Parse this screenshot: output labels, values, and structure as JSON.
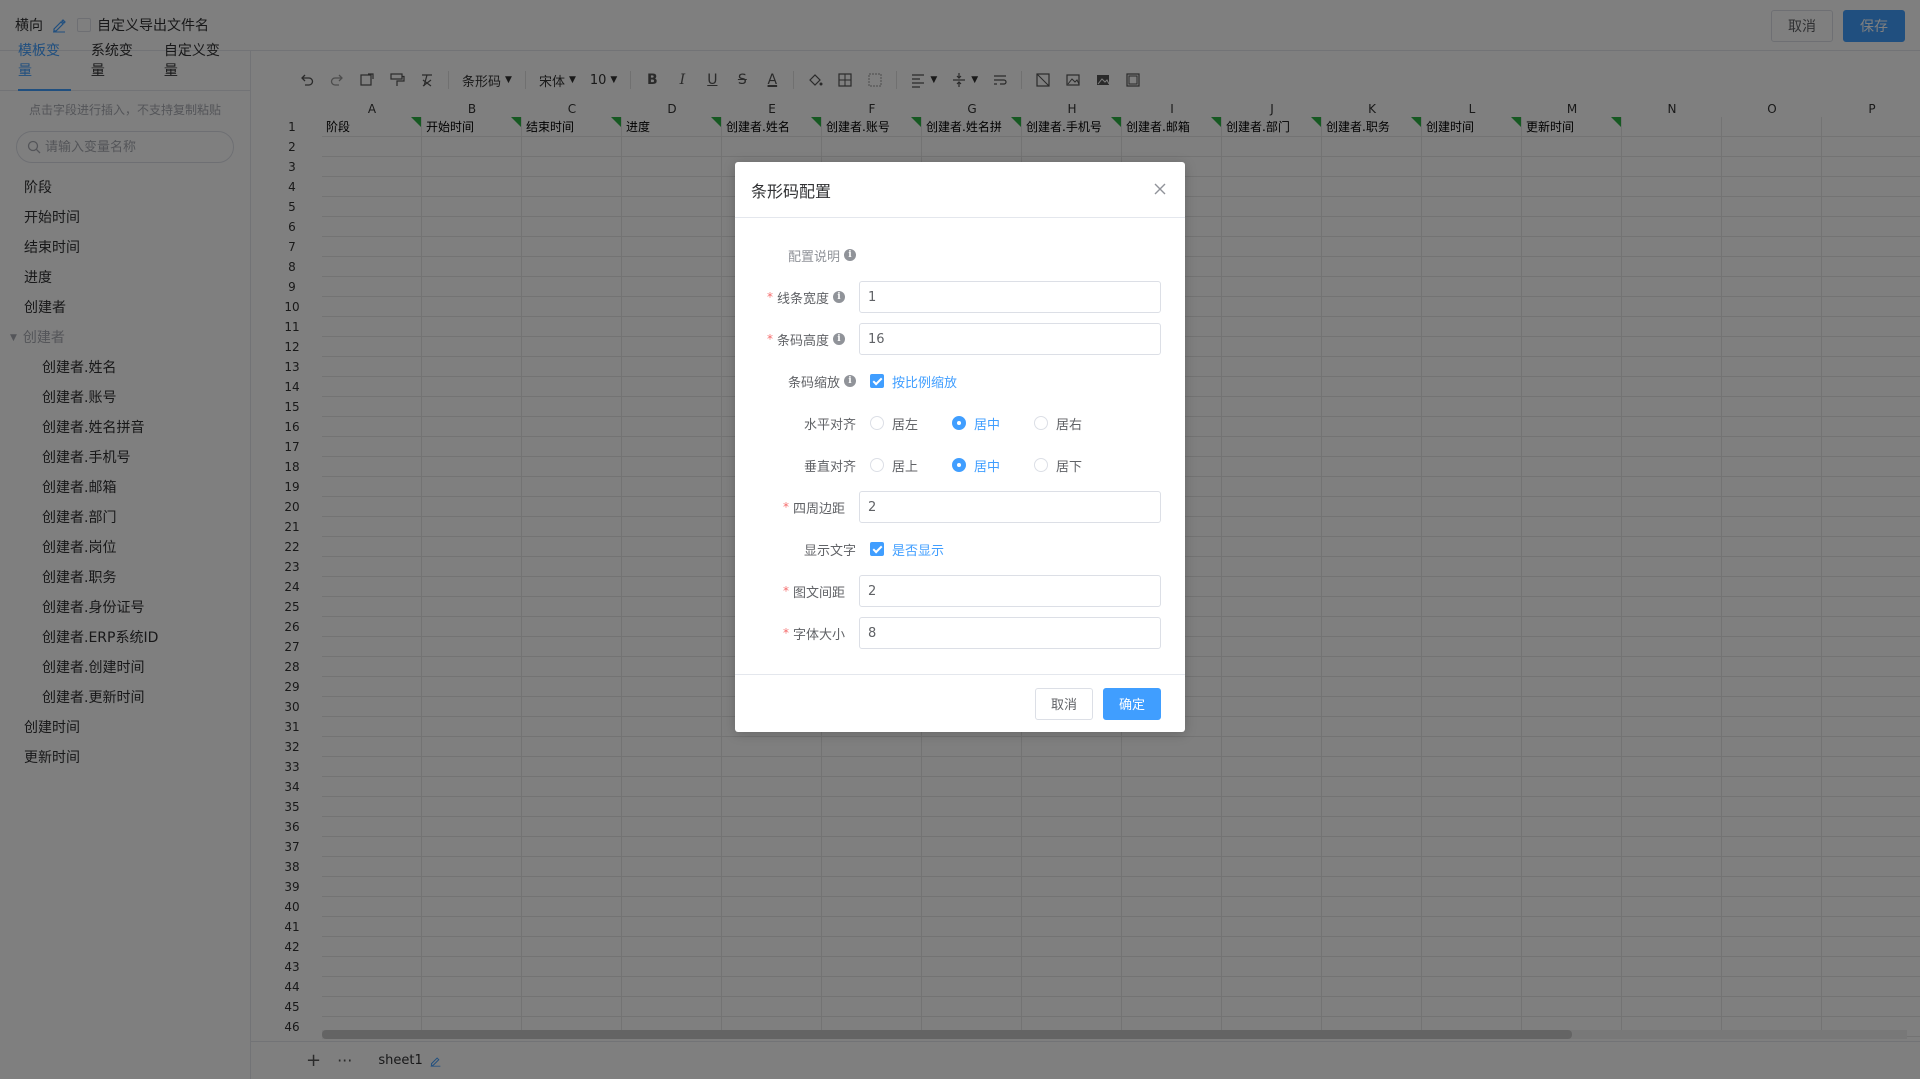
{
  "topbar": {
    "orientation": "横向",
    "custom_filename_label": "自定义导出文件名",
    "cancel_label": "取消",
    "save_label": "保存"
  },
  "left_panel": {
    "tabs": [
      {
        "label": "模板变量",
        "active": true
      },
      {
        "label": "系统变量",
        "active": false
      },
      {
        "label": "自定义变量",
        "active": false
      }
    ],
    "hint": "点击字段进行插入，不支持复制粘贴",
    "search_placeholder": "请输入变量名称",
    "variables": [
      {
        "label": "阶段",
        "kind": "item"
      },
      {
        "label": "开始时间",
        "kind": "item"
      },
      {
        "label": "结束时间",
        "kind": "item"
      },
      {
        "label": "进度",
        "kind": "item"
      },
      {
        "label": "创建者",
        "kind": "item"
      },
      {
        "label": "创建者",
        "kind": "group"
      },
      {
        "label": "创建者.姓名",
        "kind": "child"
      },
      {
        "label": "创建者.账号",
        "kind": "child"
      },
      {
        "label": "创建者.姓名拼音",
        "kind": "child"
      },
      {
        "label": "创建者.手机号",
        "kind": "child"
      },
      {
        "label": "创建者.邮箱",
        "kind": "child"
      },
      {
        "label": "创建者.部门",
        "kind": "child"
      },
      {
        "label": "创建者.岗位",
        "kind": "child"
      },
      {
        "label": "创建者.职务",
        "kind": "child"
      },
      {
        "label": "创建者.身份证号",
        "kind": "child"
      },
      {
        "label": "创建者.ERP系统ID",
        "kind": "child"
      },
      {
        "label": "创建者.创建时间",
        "kind": "child"
      },
      {
        "label": "创建者.更新时间",
        "kind": "child"
      },
      {
        "label": "创建时间",
        "kind": "item"
      },
      {
        "label": "更新时间",
        "kind": "item"
      }
    ]
  },
  "toolbar": {
    "barcode_label": "条形码",
    "font_label": "宋体",
    "size_label": "10",
    "bold": "B",
    "italic": "I",
    "underline": "U",
    "strike": "S",
    "font_color": "A",
    "icons": [
      "undo-icon",
      "redo-icon",
      "format-icon",
      "paint-format-icon",
      "clear-format-icon"
    ]
  },
  "sheet": {
    "columns": [
      "A",
      "B",
      "C",
      "D",
      "E",
      "F",
      "G",
      "H",
      "I",
      "J",
      "K",
      "L",
      "M",
      "N",
      "O",
      "P"
    ],
    "header_cells": [
      "阶段",
      "开始时间",
      "结束时间",
      "进度",
      "创建者.姓名",
      "创建者.账号",
      "创建者.姓名拼",
      "创建者.手机号",
      "创建者.邮箱",
      "创建者.部门",
      "创建者.职务",
      "创建时间",
      "更新时间",
      "",
      "",
      ""
    ],
    "row_count": 46,
    "tab_name": "sheet1",
    "add_label": "+",
    "more_label": "···"
  },
  "dialog": {
    "title": "条形码配置",
    "fields": {
      "desc_label": "配置说明",
      "line_width_label": "线条宽度",
      "line_width_value": "1",
      "bar_height_label": "条码高度",
      "bar_height_value": "16",
      "scale_label": "条码缩放",
      "scale_check_label": "按比例缩放",
      "h_align_label": "水平对齐",
      "h_align_options": [
        "居左",
        "居中",
        "居右"
      ],
      "h_align_selected": "居中",
      "v_align_label": "垂直对齐",
      "v_align_options": [
        "居上",
        "居中",
        "居下"
      ],
      "v_align_selected": "居中",
      "margin_label": "四周边距",
      "margin_value": "2",
      "show_text_label": "显示文字",
      "show_text_check_label": "是否显示",
      "text_gap_label": "图文间距",
      "text_gap_value": "2",
      "font_size_label": "字体大小",
      "font_size_value": "8"
    },
    "cancel_label": "取消",
    "ok_label": "确定"
  },
  "colors": {
    "accent": "#409eff",
    "tag_green": "#2db344",
    "required": "#f56c6c"
  }
}
